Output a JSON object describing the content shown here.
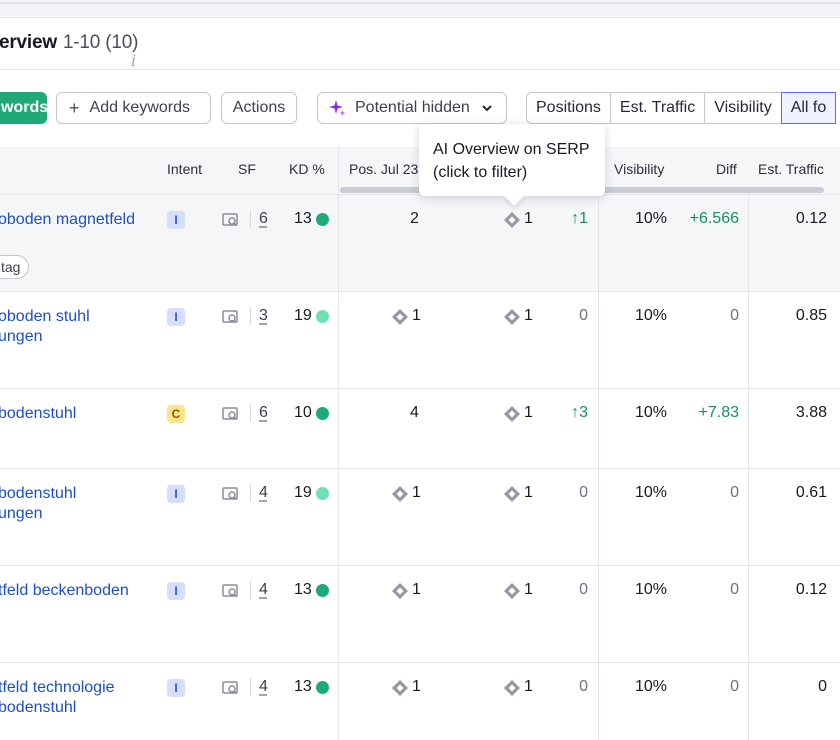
{
  "title": {
    "text": "Overview",
    "range": "1-10 (10)"
  },
  "toolbar": {
    "green_label": "words",
    "add_label": "Add keywords",
    "actions_label": "Actions",
    "potential_label": "Potential hidden",
    "segments": [
      "Positions",
      "Est. Traffic",
      "Visibility",
      "All fo"
    ]
  },
  "tooltip": {
    "text1": "AI Overview on SERP",
    "text2": "(click to filter)"
  },
  "columns": {
    "intent": "Intent",
    "sf": "SF",
    "kd": "KD %",
    "pos": "Pos. Jul 23",
    "visibility": "Visibility",
    "diff": "Diff",
    "traffic": "Est. Traffic"
  },
  "rows": [
    {
      "kw1": "oboden magnetfeld",
      "kw2": "",
      "tag": "tag",
      "intent": "I",
      "sf": "6",
      "kd": "13",
      "kd_color": "#1fa977",
      "pos_prev": "2",
      "pos_prev_icon": false,
      "pos": "1",
      "chg": "↑1",
      "vis": "10%",
      "diff": "+6.566",
      "traffic": "0.12"
    },
    {
      "kw1": "oboden stuhl",
      "kw2": "ungen",
      "tag": "",
      "intent": "I",
      "sf": "3",
      "kd": "19",
      "kd_color": "#6fe0b4",
      "pos_prev": "1",
      "pos_prev_icon": true,
      "pos": "1",
      "chg": "0",
      "vis": "10%",
      "diff": "0",
      "traffic": "0.85"
    },
    {
      "kw1": "bodenstuhl",
      "kw2": "",
      "tag": "",
      "intent": "C",
      "sf": "6",
      "kd": "10",
      "kd_color": "#1fa977",
      "pos_prev": "4",
      "pos_prev_icon": false,
      "pos": "1",
      "chg": "↑3",
      "vis": "10%",
      "diff": "+7.83",
      "traffic": "3.88"
    },
    {
      "kw1": "bodenstuhl",
      "kw2": "ungen",
      "tag": "",
      "intent": "I",
      "sf": "4",
      "kd": "19",
      "kd_color": "#6fe0b4",
      "pos_prev": "1",
      "pos_prev_icon": true,
      "pos": "1",
      "chg": "0",
      "vis": "10%",
      "diff": "0",
      "traffic": "0.61"
    },
    {
      "kw1": "tfeld beckenboden",
      "kw2": "",
      "tag": "",
      "intent": "I",
      "sf": "4",
      "kd": "13",
      "kd_color": "#1fa977",
      "pos_prev": "1",
      "pos_prev_icon": true,
      "pos": "1",
      "chg": "0",
      "vis": "10%",
      "diff": "0",
      "traffic": "0.12"
    },
    {
      "kw1": "tfeld technologie",
      "kw2": "bodenstuhl",
      "tag": "",
      "intent": "I",
      "sf": "4",
      "kd": "13",
      "kd_color": "#1fa977",
      "pos_prev": "1",
      "pos_prev_icon": true,
      "pos": "1",
      "chg": "0",
      "vis": "10%",
      "diff": "0",
      "traffic": "0"
    }
  ]
}
